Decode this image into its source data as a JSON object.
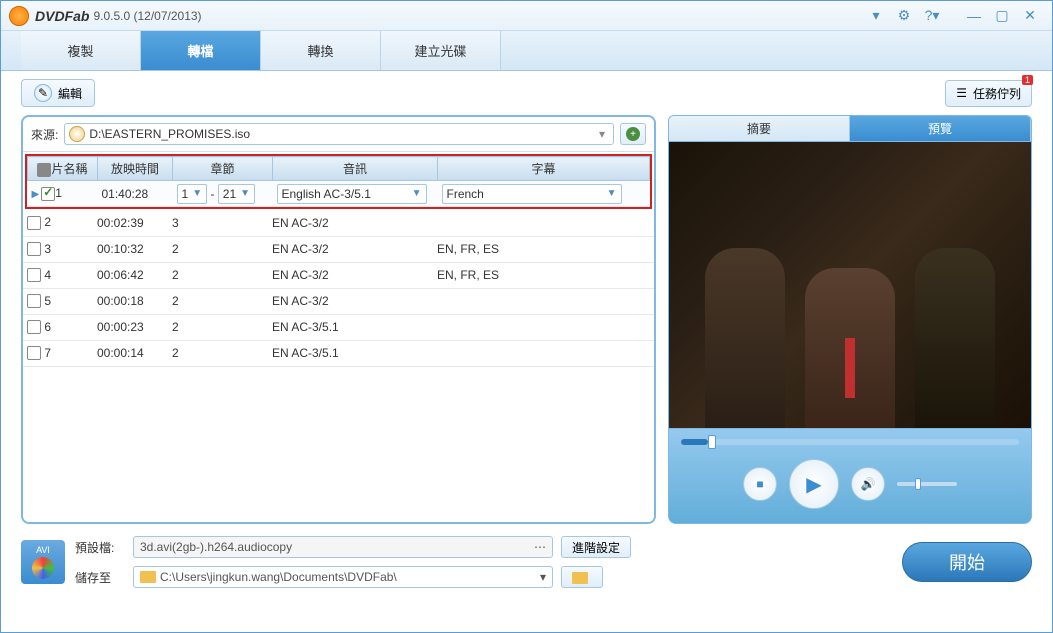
{
  "app": {
    "name": "DVDFab",
    "version": "9.0.5.0 (12/07/2013)"
  },
  "tabs": {
    "copy": "複製",
    "rip": "轉檔",
    "convert": "轉換",
    "creator": "建立光碟"
  },
  "toolbar": {
    "edit": "編輯",
    "task_queue": "任務佇列",
    "task_badge": "1"
  },
  "source": {
    "label": "來源:",
    "path": "D:\\EASTERN_PROMISES.iso"
  },
  "table": {
    "headers": {
      "name": "片名稱",
      "runtime": "放映時間",
      "chapter": "章節",
      "audio": "音訊",
      "subtitle": "字幕"
    },
    "rows": [
      {
        "idx": "1",
        "checked": true,
        "playing": true,
        "runtime": "01:40:28",
        "ch_from": "1",
        "ch_to": "21",
        "audio": "English AC-3/5.1",
        "subtitle": "French",
        "dd": true
      },
      {
        "idx": "2",
        "checked": false,
        "runtime": "00:02:39",
        "chapter": "3",
        "audio": "EN AC-3/2",
        "subtitle": ""
      },
      {
        "idx": "3",
        "checked": false,
        "runtime": "00:10:32",
        "chapter": "2",
        "audio": "EN AC-3/2",
        "subtitle": "EN, FR, ES"
      },
      {
        "idx": "4",
        "checked": false,
        "runtime": "00:06:42",
        "chapter": "2",
        "audio": "EN AC-3/2",
        "subtitle": "EN, FR, ES"
      },
      {
        "idx": "5",
        "checked": false,
        "runtime": "00:00:18",
        "chapter": "2",
        "audio": "EN AC-3/2",
        "subtitle": ""
      },
      {
        "idx": "6",
        "checked": false,
        "runtime": "00:00:23",
        "chapter": "2",
        "audio": "EN AC-3/5.1",
        "subtitle": ""
      },
      {
        "idx": "7",
        "checked": false,
        "runtime": "00:00:14",
        "chapter": "2",
        "audio": "EN AC-3/5.1",
        "subtitle": ""
      }
    ]
  },
  "preview": {
    "summary_tab": "摘要",
    "preview_tab": "預覽"
  },
  "bottom": {
    "fmt_label": "AVI",
    "preset_label": "預設檔:",
    "preset_value": "3d.avi(2gb-).h264.audiocopy",
    "advanced": "進階設定",
    "save_label": "儲存至",
    "save_path": "C:\\Users\\jingkun.wang\\Documents\\DVDFab\\",
    "start": "開始"
  }
}
